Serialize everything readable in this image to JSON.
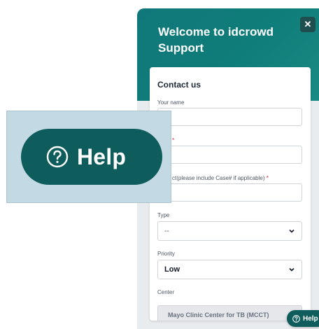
{
  "widget": {
    "title": "Welcome to idcrowd Support",
    "close_icon": "close-icon",
    "close_glyph": "✕"
  },
  "form": {
    "heading": "Contact us",
    "your_name": {
      "label": "Your name",
      "value": ""
    },
    "email": {
      "label": "*",
      "value": ""
    },
    "subject": {
      "label": "ct(please include Case# if applicable)",
      "required_mark": "*",
      "value": ""
    },
    "type": {
      "label": "Type",
      "selected": "--"
    },
    "priority": {
      "label": "Priority",
      "selected": "Low"
    },
    "center": {
      "label": "Center",
      "value": "Mayo Clinic Center for TB (MCCT)"
    }
  },
  "help_zoom": {
    "label": "Help",
    "icon": "question-circle-icon"
  },
  "help_button": {
    "label": "Help",
    "icon": "question-circle-icon"
  },
  "colors": {
    "header_teal": "#10787a",
    "help_teal": "#0f5c5c",
    "required_red": "#d11d2a"
  }
}
